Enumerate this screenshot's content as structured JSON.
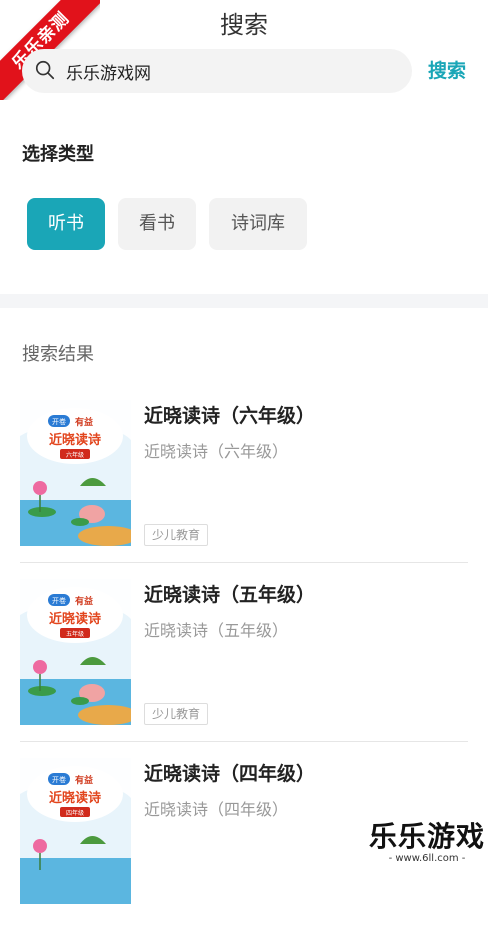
{
  "header": {
    "title": "搜索"
  },
  "corner_badge": "乐乐亲测",
  "search": {
    "value": "乐乐游戏网",
    "button_label": "搜索"
  },
  "type_section": {
    "label": "选择类型",
    "chips": [
      {
        "label": "听书",
        "active": true
      },
      {
        "label": "看书",
        "active": false
      },
      {
        "label": "诗词库",
        "active": false
      }
    ]
  },
  "results": {
    "label": "搜索结果",
    "items": [
      {
        "title": "近晓读诗（六年级）",
        "subtitle": "近晓读诗（六年级）",
        "tag": "少儿教育",
        "cover": {
          "badge_left": "开卷",
          "badge_right": "有益",
          "title": "近晓读诗",
          "grade": "六年级"
        }
      },
      {
        "title": "近晓读诗（五年级）",
        "subtitle": "近晓读诗（五年级）",
        "tag": "少儿教育",
        "cover": {
          "badge_left": "开卷",
          "badge_right": "有益",
          "title": "近晓读诗",
          "grade": "五年级"
        }
      },
      {
        "title": "近晓读诗（四年级）",
        "subtitle": "近晓读诗（四年级）",
        "tag": "",
        "cover": {
          "badge_left": "开卷",
          "badge_right": "有益",
          "title": "近晓读诗",
          "grade": "四年级"
        }
      }
    ]
  },
  "watermark": {
    "main": "乐乐游戏",
    "sub": "- www.6ll.com -"
  },
  "colors": {
    "accent": "#1aa6b7",
    "badge_red": "#e1121b"
  }
}
